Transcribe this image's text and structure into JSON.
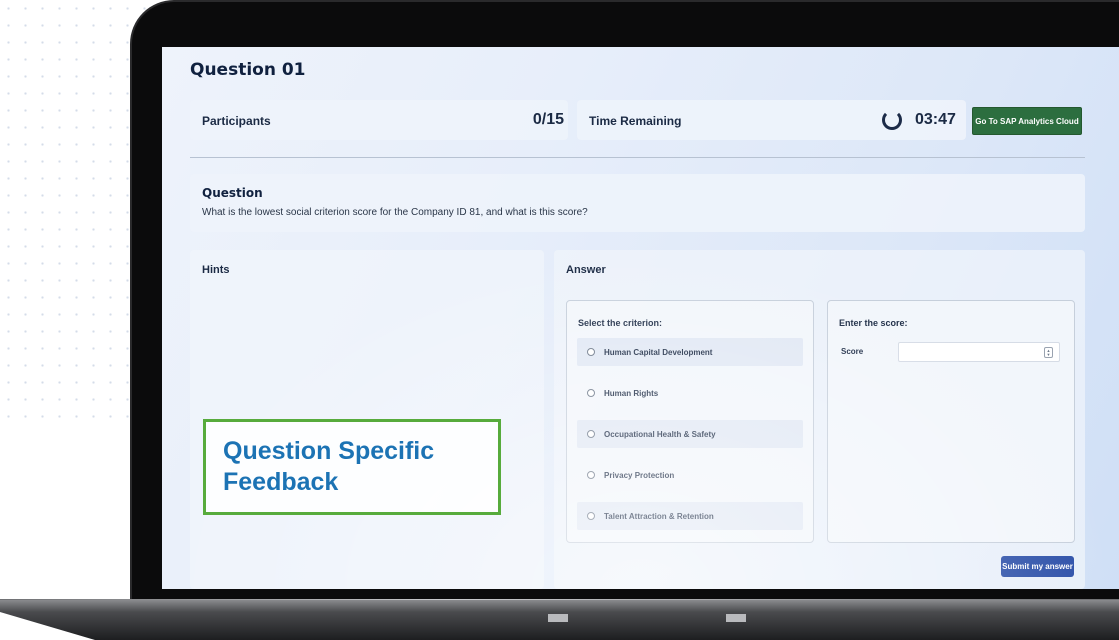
{
  "question": {
    "title": "Question 01",
    "heading": "Question",
    "text": "What is the lowest social criterion score for the Company ID 81, and what is this score?"
  },
  "status_bar": {
    "participants_label": "Participants",
    "participants_value": "0/15",
    "time_label": "Time Remaining",
    "time_value": "03:47",
    "sac_button_label": "Go To SAP Analytics Cloud"
  },
  "hints": {
    "title": "Hints"
  },
  "answer": {
    "title": "Answer",
    "criterion_label": "Select the criterion:",
    "options": [
      "Human Capital Development",
      "Human Rights",
      "Occupational Health & Safety",
      "Privacy Protection",
      "Talent Attraction & Retention"
    ],
    "score_section_label": "Enter the score:",
    "score_field_label": "Score",
    "score_value": "",
    "submit_label": "Submit my answer"
  },
  "overlay": {
    "feedback_text": "Question Specific Feedback"
  },
  "colors": {
    "sac_button": "#2c6e3f",
    "submit_button": "#2b4fa8",
    "feedback_border": "#57ab3c",
    "feedback_text": "#1c73b4"
  },
  "icons": [
    "loading-spinner-icon",
    "number-stepper-icon",
    "radio-icon"
  ]
}
